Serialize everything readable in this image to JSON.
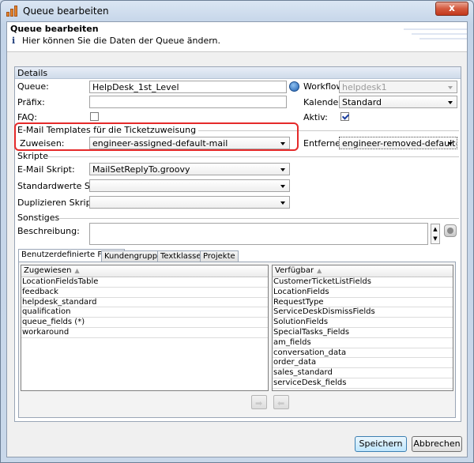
{
  "window": {
    "title": "Queue bearbeiten",
    "close_label": "x"
  },
  "header": {
    "title": "Queue bearbeiten",
    "info_icon": "info-icon",
    "subtitle": "Hier können Sie die Daten der Queue ändern."
  },
  "details": {
    "section_title": "Details",
    "queue_label": "Queue:",
    "queue_value": "HelpDesk_1st_Level",
    "prefix_label": "Präfix:",
    "prefix_value": "",
    "faq_label": "FAQ:",
    "faq_checked": false,
    "workflow_label": "Workflow:",
    "workflow_value": "helpdesk1",
    "calendar_label": "Kalender:",
    "calendar_value": "Standard",
    "active_label": "Aktiv:",
    "active_checked": true
  },
  "email_templates": {
    "section_title": "E-Mail Templates für die Ticketzuweisung",
    "assign_label": "Zuweisen:",
    "assign_value": "engineer-assigned-default-mail",
    "remove_label": "Entfernen:",
    "remove_value": "engineer-removed-default-mail"
  },
  "scripts": {
    "section_title": "Skripte",
    "email_label": "E-Mail Skript:",
    "email_value": "MailSetReplyTo.groovy",
    "defaults_label": "Standardwerte Skript:",
    "defaults_value": "",
    "duplicate_label": "Duplizieren Skript:",
    "duplicate_value": ""
  },
  "misc": {
    "section_title": "Sonstiges",
    "description_label": "Beschreibung:",
    "description_value": ""
  },
  "tabs": [
    {
      "label": "Benutzerdefinierte Felder"
    },
    {
      "label": "Kundengruppen"
    },
    {
      "label": "Textklassen"
    },
    {
      "label": "Projekte"
    }
  ],
  "assigned_list": {
    "header": "Zugewiesen",
    "items": [
      "LocationFieldsTable",
      "feedback",
      "helpdesk_standard",
      "qualification",
      "queue_fields (*)",
      "workaround"
    ]
  },
  "available_list": {
    "header": "Verfügbar",
    "items": [
      "CustomerTicketListFields",
      "LocationFields",
      "RequestType",
      "ServiceDeskDismissFields",
      "SolutionFields",
      "SpecialTasks_Fields",
      "am_fields",
      "conversation_data",
      "order_data",
      "sales_standard",
      "serviceDesk_fields"
    ]
  },
  "footer": {
    "save_label": "Speichern",
    "cancel_label": "Abbrechen"
  },
  "colors": {
    "highlight": "#e52a2a",
    "accent": "#3c7fb1"
  }
}
